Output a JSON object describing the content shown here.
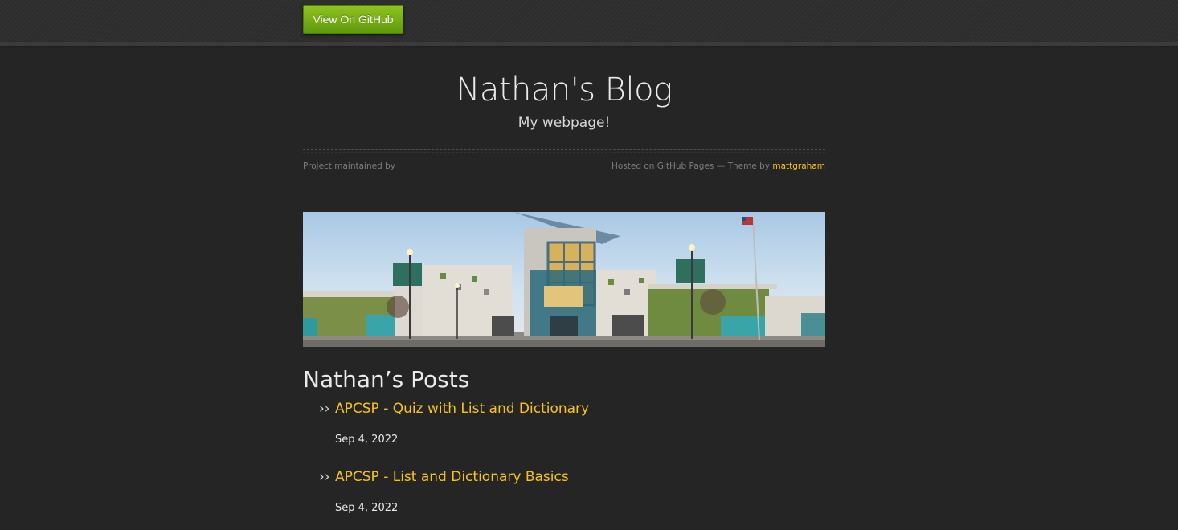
{
  "header": {
    "github_button_label": "View On GitHub"
  },
  "site": {
    "title": "Nathan's Blog",
    "tagline": "My webpage!",
    "maintained_by": "Project maintained by",
    "hosted_text": "Hosted on GitHub Pages — Theme by ",
    "theme_author": "mattgraham"
  },
  "posts_section": {
    "heading": "Nathan’s Posts",
    "bullet": "››",
    "items": [
      {
        "title": "APCSP - Quiz with List and Dictionary",
        "date": "Sep 4, 2022"
      },
      {
        "title": "APCSP - List and Dictionary Basics",
        "date": "Sep 4, 2022"
      }
    ]
  },
  "colors": {
    "background": "#252525",
    "link": "#f7c315",
    "button_green": "#7bb01a"
  }
}
